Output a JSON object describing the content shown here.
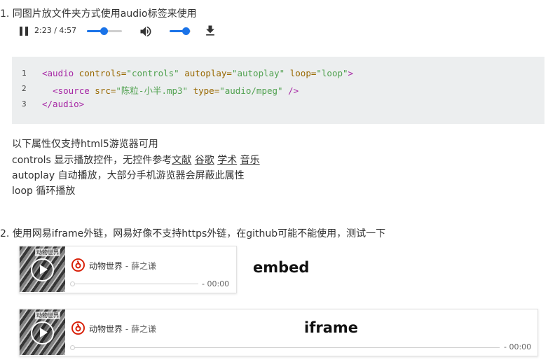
{
  "section1": {
    "heading": "1. 同图片放文件夹方式使用audio标签来使用",
    "player": {
      "time": "2:23 / 4:57",
      "progress_fraction": 0.48,
      "volume_fraction": 0.75,
      "pause_icon": "pause-icon",
      "volume_icon": "volume-icon",
      "download_icon": "download-icon",
      "accent_color": "#1a73e8"
    },
    "code": {
      "line_numbers": [
        "1",
        "2",
        "3"
      ],
      "line1": {
        "open": "<audio",
        "a1": " controls=",
        "v1": "\"controls\"",
        "a2": " autoplay=",
        "v2": "\"autoplay\"",
        "a3": " loop=",
        "v3": "\"loop\"",
        "close": ">"
      },
      "line2": {
        "indent": "  ",
        "open": "<source",
        "a1": " src=",
        "v1": "\"陈粒-小半.mp3\"",
        "a2": " type=",
        "v2": "\"audio/mpeg\"",
        "close": " />"
      },
      "line3": {
        "tag": "</audio>"
      }
    },
    "notes": {
      "line1": "以下属性仅支持html5游览器可用",
      "line2_prefix": "controls 显示播放控件，无控件参考",
      "links": [
        "文献",
        "谷歌",
        "学术",
        "音乐"
      ],
      "line3": "autoplay 自动播放，大部分手机游览器会屏蔽此属性",
      "line4": "loop 循环播放"
    }
  },
  "section2": {
    "heading": "2. 使用网易iframe外链，网易好像不支持https外链，在github可能不能使用，测试一下",
    "cards": [
      {
        "cover_title": "动物世界",
        "song": "动物世界",
        "artist": " - 薛之谦",
        "duration": "- 00:00",
        "label": "embed",
        "logo_icon": "netease-music-icon",
        "logo_color": "#d81e06"
      },
      {
        "cover_title": "动物世界",
        "song": "动物世界",
        "artist": " - 薛之谦",
        "duration": "- 00:00",
        "label": "iframe",
        "logo_icon": "netease-music-icon",
        "logo_color": "#d81e06"
      }
    ]
  }
}
